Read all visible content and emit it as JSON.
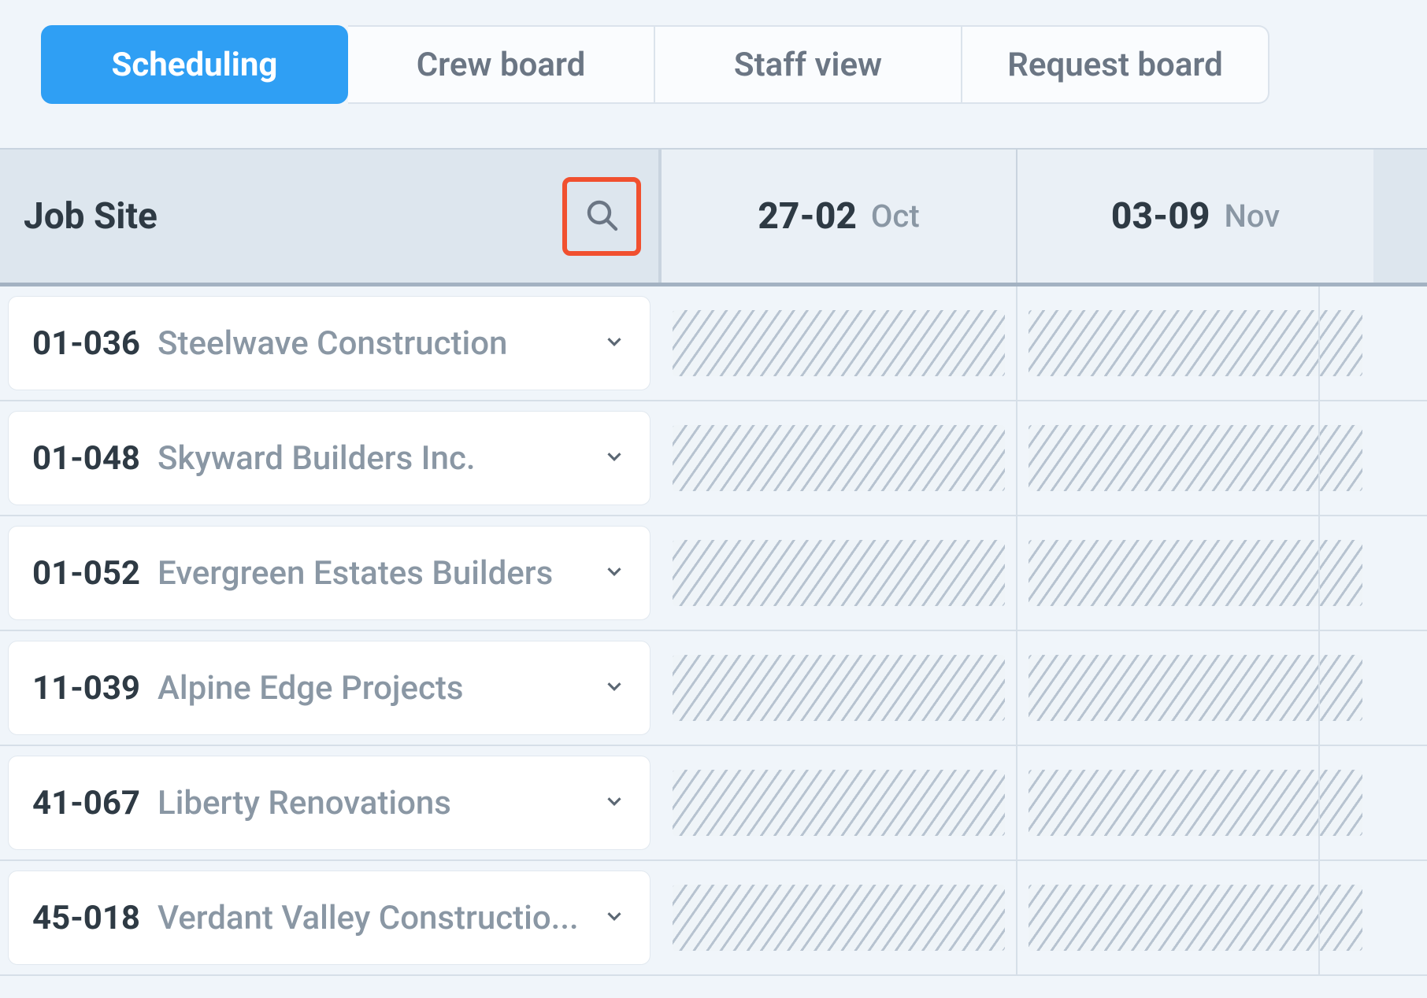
{
  "tabs": [
    {
      "label": "Scheduling",
      "active": true
    },
    {
      "label": "Crew board",
      "active": false
    },
    {
      "label": "Staff view",
      "active": false
    },
    {
      "label": "Request board",
      "active": false
    }
  ],
  "header": {
    "column_title": "Job Site",
    "date_columns": [
      {
        "range": "27-02",
        "month": "Oct"
      },
      {
        "range": "03-09",
        "month": "Nov"
      }
    ]
  },
  "rows": [
    {
      "code": "01-036",
      "name": "Steelwave Construction"
    },
    {
      "code": "01-048",
      "name": "Skyward Builders Inc."
    },
    {
      "code": "01-052",
      "name": "Evergreen Estates Builders"
    },
    {
      "code": "11-039",
      "name": "Alpine Edge Projects"
    },
    {
      "code": "41-067",
      "name": "Liberty Renovations"
    },
    {
      "code": "45-018",
      "name": "Verdant Valley Constructio..."
    }
  ],
  "icons": {
    "search": "search-icon",
    "chevron_down": "chevron-down-icon"
  },
  "colors": {
    "accent": "#2f9ff4",
    "highlight_box": "#f1502f",
    "text_primary": "#2e3a44",
    "text_muted": "#8a97a4"
  }
}
